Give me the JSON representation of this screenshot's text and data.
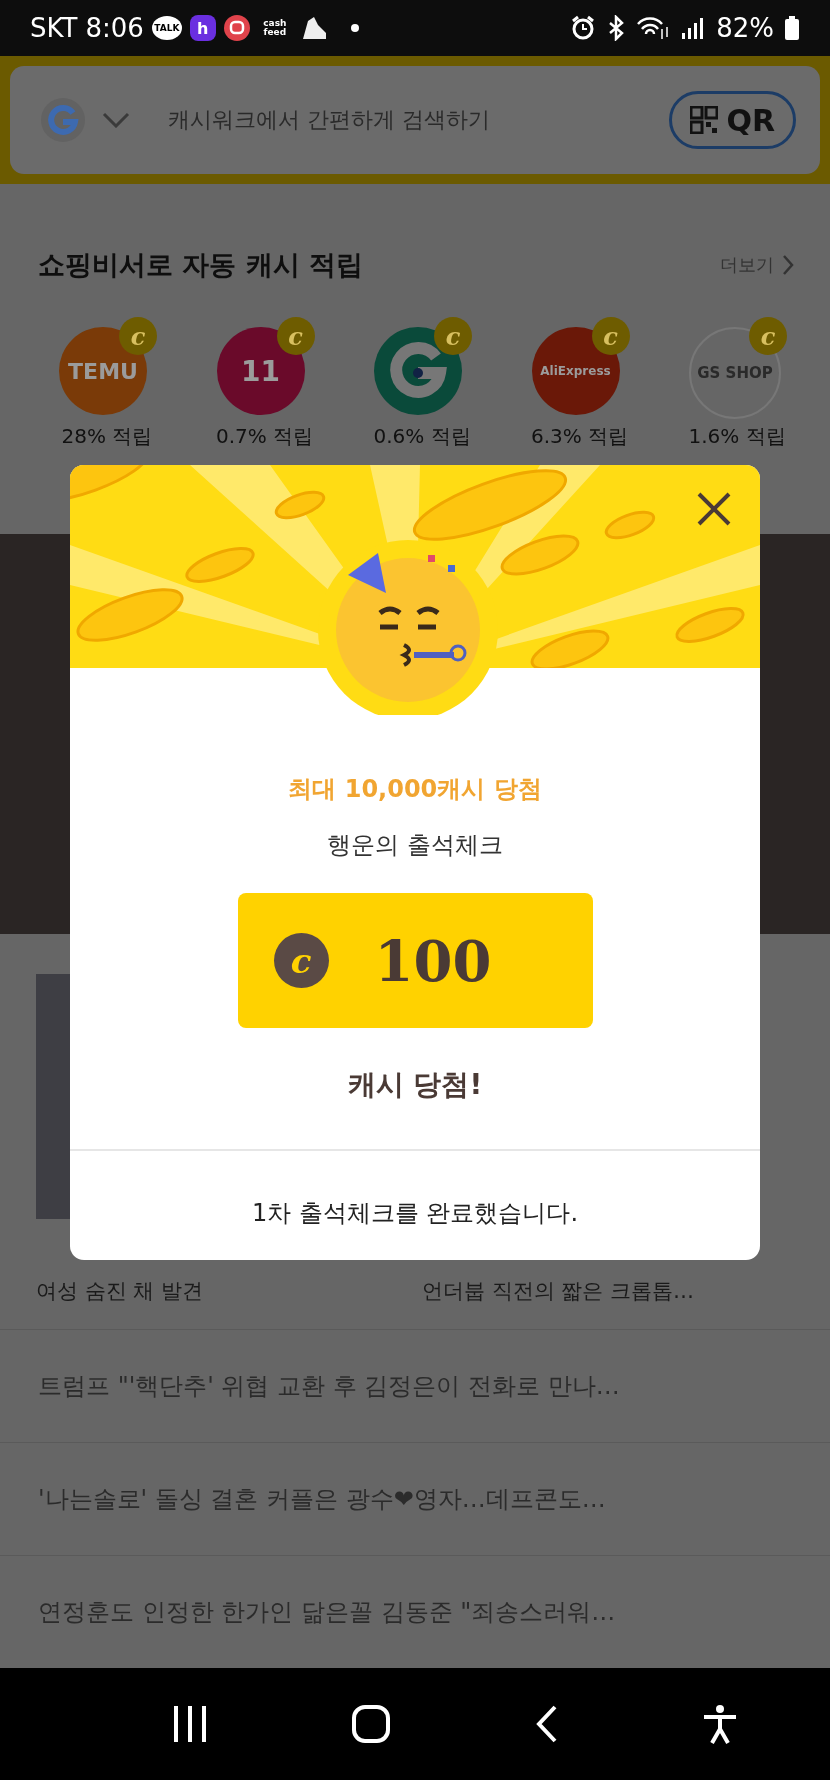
{
  "status_bar": {
    "carrier": "SKT",
    "time": "8:06",
    "notifications": [
      {
        "kind": "talk",
        "label": "TALK"
      },
      {
        "kind": "h",
        "label": "h"
      },
      {
        "kind": "q"
      },
      {
        "kind": "cashfeed",
        "label": "cash feed"
      },
      {
        "kind": "shoe"
      },
      {
        "kind": "dot"
      }
    ],
    "battery": "82%"
  },
  "search": {
    "placeholder": "캐시워크에서 간편하게 검색하기",
    "qr_label": "QR"
  },
  "shopping": {
    "title": "쇼핑비서로 자동 캐시 적립",
    "more": "더보기",
    "stores": [
      {
        "kind": "temu",
        "logo_text": "TEMU",
        "badge_symbol": "c",
        "rate": "28% 적립"
      },
      {
        "kind": "eleven",
        "logo_text": "11",
        "badge_symbol": "c",
        "rate": "0.7% 적립"
      },
      {
        "kind": "g",
        "badge_symbol": "c",
        "rate": "0.6% 적립"
      },
      {
        "kind": "aliexpress",
        "logo_text": "AliExpress",
        "badge_symbol": "c",
        "rate": "6.3% 적립"
      },
      {
        "kind": "gsshop",
        "logo_text": "GS SHOP",
        "badge_symbol": "c",
        "rate": "1.6% 적립"
      }
    ]
  },
  "news_cards": [
    {
      "caption": "여성 숨진 채 발견"
    },
    {
      "caption": "언더붑 직전의 짧은 크롭톱…"
    }
  ],
  "headlines": [
    "트럼프 \"'핵단추' 위협 교환 후 김정은이 전화로 만나…",
    "'나는솔로' 돌싱 결혼 커플은 광수❤영자…데프콘도…",
    "연정훈도 인정한 한가인 닮은꼴 김동준 \"죄송스러워…"
  ],
  "modal": {
    "title": "최대 10,000캐시 당첨",
    "subtitle": "행운의 출석체크",
    "coin_symbol": "c",
    "amount": "100",
    "result": "캐시 당첨!",
    "message": "1차 출석체크를 완료했습니다."
  }
}
